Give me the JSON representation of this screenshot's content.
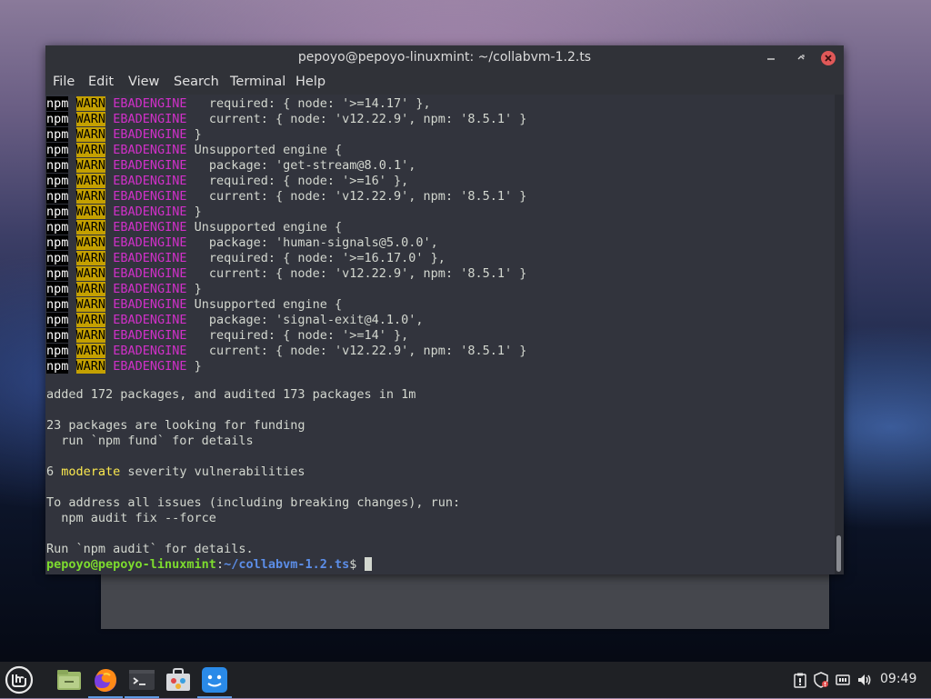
{
  "window": {
    "title": "pepoyo@pepoyo-linuxmint: ~/collabvm-1.2.ts"
  },
  "menu": [
    "File",
    "Edit",
    "View",
    "Search",
    "Terminal",
    "Help"
  ],
  "terminal": {
    "warn_lines": [
      {
        "npm": "npm",
        "warn": "WARN",
        "code": "EBADENGINE",
        "text": "   required: { node: '>=14.17' },"
      },
      {
        "npm": "npm",
        "warn": "WARN",
        "code": "EBADENGINE",
        "text": "   current: { node: 'v12.22.9', npm: '8.5.1' }"
      },
      {
        "npm": "npm",
        "warn": "WARN",
        "code": "EBADENGINE",
        "text": " }"
      },
      {
        "npm": "npm",
        "warn": "WARN",
        "code": "EBADENGINE",
        "text": " Unsupported engine {"
      },
      {
        "npm": "npm",
        "warn": "WARN",
        "code": "EBADENGINE",
        "text": "   package: 'get-stream@8.0.1',"
      },
      {
        "npm": "npm",
        "warn": "WARN",
        "code": "EBADENGINE",
        "text": "   required: { node: '>=16' },"
      },
      {
        "npm": "npm",
        "warn": "WARN",
        "code": "EBADENGINE",
        "text": "   current: { node: 'v12.22.9', npm: '8.5.1' }"
      },
      {
        "npm": "npm",
        "warn": "WARN",
        "code": "EBADENGINE",
        "text": " }"
      },
      {
        "npm": "npm",
        "warn": "WARN",
        "code": "EBADENGINE",
        "text": " Unsupported engine {"
      },
      {
        "npm": "npm",
        "warn": "WARN",
        "code": "EBADENGINE",
        "text": "   package: 'human-signals@5.0.0',"
      },
      {
        "npm": "npm",
        "warn": "WARN",
        "code": "EBADENGINE",
        "text": "   required: { node: '>=16.17.0' },"
      },
      {
        "npm": "npm",
        "warn": "WARN",
        "code": "EBADENGINE",
        "text": "   current: { node: 'v12.22.9', npm: '8.5.1' }"
      },
      {
        "npm": "npm",
        "warn": "WARN",
        "code": "EBADENGINE",
        "text": " }"
      },
      {
        "npm": "npm",
        "warn": "WARN",
        "code": "EBADENGINE",
        "text": " Unsupported engine {"
      },
      {
        "npm": "npm",
        "warn": "WARN",
        "code": "EBADENGINE",
        "text": "   package: 'signal-exit@4.1.0',"
      },
      {
        "npm": "npm",
        "warn": "WARN",
        "code": "EBADENGINE",
        "text": "   required: { node: '>=14' },"
      },
      {
        "npm": "npm",
        "warn": "WARN",
        "code": "EBADENGINE",
        "text": "   current: { node: 'v12.22.9', npm: '8.5.1' }"
      },
      {
        "npm": "npm",
        "warn": "WARN",
        "code": "EBADENGINE",
        "text": " }"
      }
    ],
    "summary": {
      "added": "added 172 packages, and audited 173 packages in 1m",
      "funding": "23 packages are looking for funding",
      "funding_hint": "  run `npm fund` for details",
      "vuln_count": "6 ",
      "vuln_severity": "moderate",
      "vuln_rest": " severity vulnerabilities",
      "address": "To address all issues (including breaking changes), run:",
      "address_cmd": "  npm audit fix --force",
      "run_audit": "Run `npm audit` for details."
    },
    "prompt": {
      "user_host": "pepoyo@pepoyo-linuxmint",
      "colon": ":",
      "path": "~/collabvm-1.2.ts",
      "symbol": "$ "
    }
  },
  "taskbar": {
    "apps": [
      "menu-icon",
      "files-icon",
      "firefox-icon",
      "terminal-icon",
      "software-manager-icon",
      "collabvm-app-icon"
    ],
    "tray": [
      "clipboard-icon",
      "shield-icon",
      "network-icon",
      "volume-icon"
    ],
    "clock": "09:49"
  },
  "colors": {
    "terminal_bg": "#32343d",
    "warn_bg": "#c4a000",
    "code_magenta": "#d030c8",
    "prompt_green": "#7ddc2e",
    "prompt_blue": "#5c8ee8",
    "moderate_yellow": "#fce94f"
  }
}
